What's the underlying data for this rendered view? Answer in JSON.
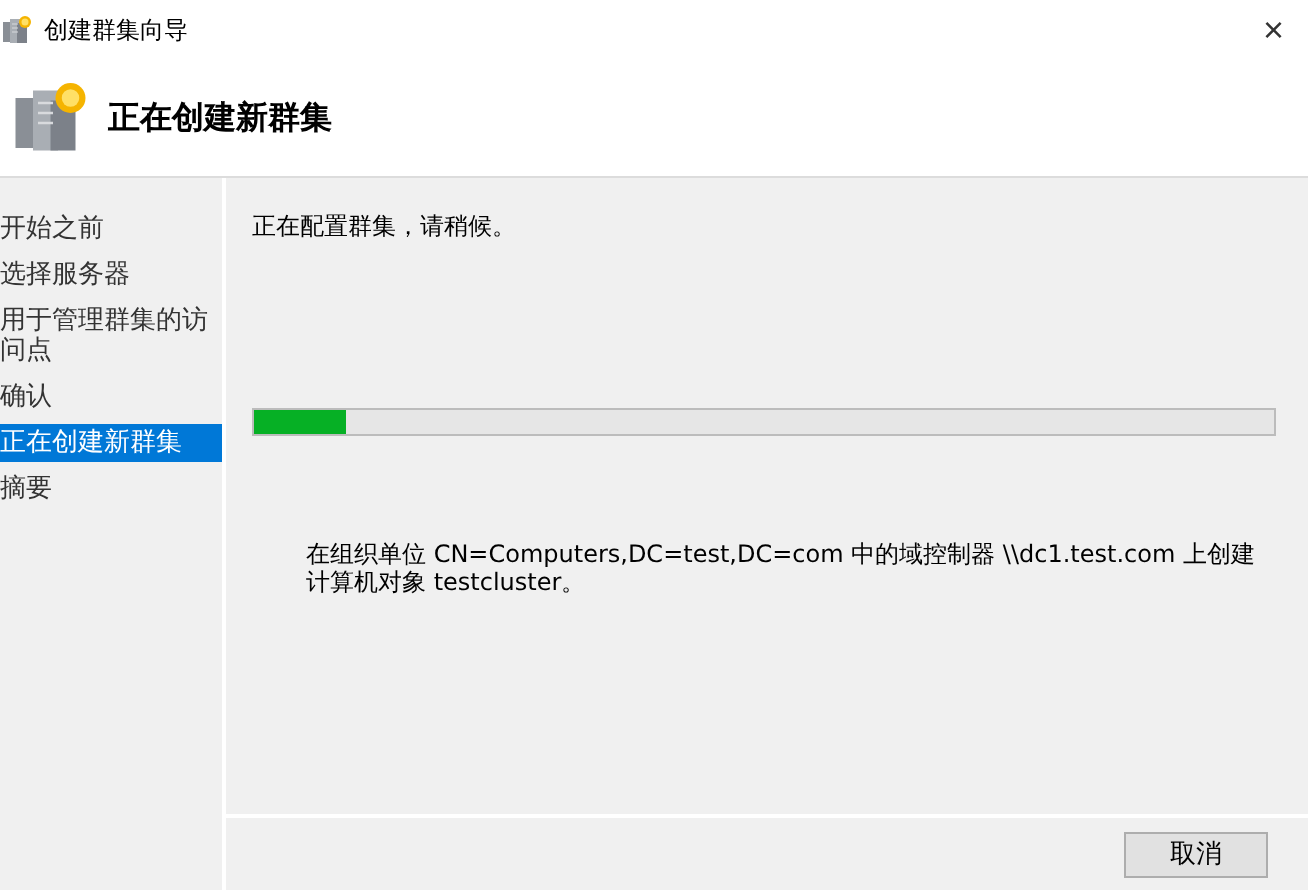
{
  "window": {
    "title": "创建群集向导",
    "close": "×"
  },
  "header": {
    "title": "正在创建新群集"
  },
  "sidebar": {
    "items": [
      {
        "label": "开始之前",
        "selected": false
      },
      {
        "label": "选择服务器",
        "selected": false
      },
      {
        "label": "用于管理群集的访问点",
        "selected": false
      },
      {
        "label": "确认",
        "selected": false
      },
      {
        "label": "正在创建新群集",
        "selected": true
      },
      {
        "label": "摘要",
        "selected": false
      }
    ]
  },
  "content": {
    "status": "正在配置群集，请稍候。",
    "progress": {
      "level": 0.09
    },
    "message": "在组织单位 CN=Computers,DC=test,DC=com 中的域控制器 \\\\dc1.test.com 上创建计算机对象 testcluster。"
  },
  "buttons": [
    {
      "label": "取消"
    }
  ]
}
